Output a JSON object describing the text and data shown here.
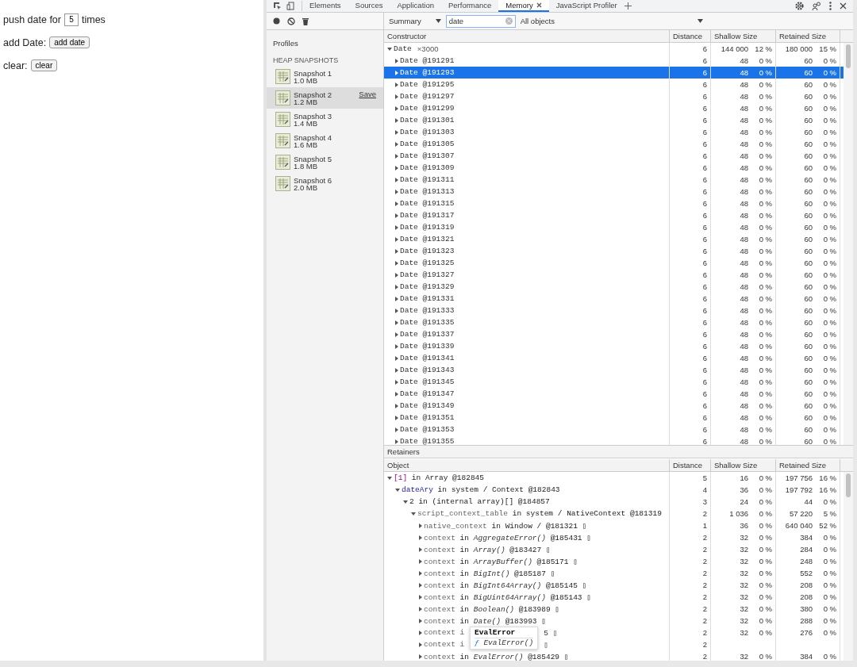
{
  "page": {
    "lines": [
      {
        "kind": "input",
        "label": "push date for",
        "value": "5",
        "after": "times"
      },
      {
        "kind": "button",
        "label": "add Date:",
        "button": "add date"
      },
      {
        "kind": "button",
        "label": "clear:",
        "button": "clear"
      }
    ]
  },
  "devtools": {
    "tabs": [
      {
        "label": "Elements",
        "selected": false,
        "closable": false
      },
      {
        "label": "Sources",
        "selected": false,
        "closable": false
      },
      {
        "label": "Application",
        "selected": false,
        "closable": false
      },
      {
        "label": "Performance",
        "selected": false,
        "closable": false
      },
      {
        "label": "Memory",
        "selected": true,
        "closable": true
      },
      {
        "label": "JavaScript Profiler",
        "selected": false,
        "closable": false
      }
    ],
    "toolbar": {
      "view": "Summary",
      "filter": "date",
      "objects": "All objects"
    },
    "sidebar": {
      "title": "Profiles",
      "section": "HEAP SNAPSHOTS",
      "snapshots": [
        {
          "name": "Snapshot 1",
          "size": "1.0 MB",
          "selected": false
        },
        {
          "name": "Snapshot 2",
          "size": "1.2 MB",
          "selected": true,
          "action": "Save"
        },
        {
          "name": "Snapshot 3",
          "size": "1.4 MB",
          "selected": false
        },
        {
          "name": "Snapshot 4",
          "size": "1.6 MB",
          "selected": false
        },
        {
          "name": "Snapshot 5",
          "size": "1.8 MB",
          "selected": false
        },
        {
          "name": "Snapshot 6",
          "size": "2.0 MB",
          "selected": false
        }
      ]
    },
    "summary": {
      "columns": [
        "Constructor",
        "Distance",
        "Shallow Size",
        "Retained Size"
      ],
      "rows": [
        {
          "label": "Date",
          "count": "×3000",
          "expanded": true,
          "selected": false,
          "distance": "6",
          "shallow": "144 000",
          "shallow_pct": "12 %",
          "retained": "180 000",
          "retained_pct": "15 %",
          "children": [
            {
              "label": "Date @191291",
              "expanded": false,
              "selected": false,
              "distance": "6",
              "shallow": "48",
              "shallow_pct": "0 %",
              "retained": "60",
              "retained_pct": "0 %"
            },
            {
              "label": "Date @191293",
              "expanded": false,
              "selected": true,
              "distance": "6",
              "shallow": "48",
              "shallow_pct": "0 %",
              "retained": "60",
              "retained_pct": "0 %"
            },
            {
              "label": "Date @191295",
              "expanded": false,
              "selected": false,
              "distance": "6",
              "shallow": "48",
              "shallow_pct": "0 %",
              "retained": "60",
              "retained_pct": "0 %"
            },
            {
              "label": "Date @191297",
              "expanded": false,
              "selected": false,
              "distance": "6",
              "shallow": "48",
              "shallow_pct": "0 %",
              "retained": "60",
              "retained_pct": "0 %"
            },
            {
              "label": "Date @191299",
              "expanded": false,
              "selected": false,
              "distance": "6",
              "shallow": "48",
              "shallow_pct": "0 %",
              "retained": "60",
              "retained_pct": "0 %"
            },
            {
              "label": "Date @191301",
              "expanded": false,
              "selected": false,
              "distance": "6",
              "shallow": "48",
              "shallow_pct": "0 %",
              "retained": "60",
              "retained_pct": "0 %"
            },
            {
              "label": "Date @191303",
              "expanded": false,
              "selected": false,
              "distance": "6",
              "shallow": "48",
              "shallow_pct": "0 %",
              "retained": "60",
              "retained_pct": "0 %"
            },
            {
              "label": "Date @191305",
              "expanded": false,
              "selected": false,
              "distance": "6",
              "shallow": "48",
              "shallow_pct": "0 %",
              "retained": "60",
              "retained_pct": "0 %"
            },
            {
              "label": "Date @191307",
              "expanded": false,
              "selected": false,
              "distance": "6",
              "shallow": "48",
              "shallow_pct": "0 %",
              "retained": "60",
              "retained_pct": "0 %"
            },
            {
              "label": "Date @191309",
              "expanded": false,
              "selected": false,
              "distance": "6",
              "shallow": "48",
              "shallow_pct": "0 %",
              "retained": "60",
              "retained_pct": "0 %"
            },
            {
              "label": "Date @191311",
              "expanded": false,
              "selected": false,
              "distance": "6",
              "shallow": "48",
              "shallow_pct": "0 %",
              "retained": "60",
              "retained_pct": "0 %"
            },
            {
              "label": "Date @191313",
              "expanded": false,
              "selected": false,
              "distance": "6",
              "shallow": "48",
              "shallow_pct": "0 %",
              "retained": "60",
              "retained_pct": "0 %"
            },
            {
              "label": "Date @191315",
              "expanded": false,
              "selected": false,
              "distance": "6",
              "shallow": "48",
              "shallow_pct": "0 %",
              "retained": "60",
              "retained_pct": "0 %"
            },
            {
              "label": "Date @191317",
              "expanded": false,
              "selected": false,
              "distance": "6",
              "shallow": "48",
              "shallow_pct": "0 %",
              "retained": "60",
              "retained_pct": "0 %"
            },
            {
              "label": "Date @191319",
              "expanded": false,
              "selected": false,
              "distance": "6",
              "shallow": "48",
              "shallow_pct": "0 %",
              "retained": "60",
              "retained_pct": "0 %"
            },
            {
              "label": "Date @191321",
              "expanded": false,
              "selected": false,
              "distance": "6",
              "shallow": "48",
              "shallow_pct": "0 %",
              "retained": "60",
              "retained_pct": "0 %"
            },
            {
              "label": "Date @191323",
              "expanded": false,
              "selected": false,
              "distance": "6",
              "shallow": "48",
              "shallow_pct": "0 %",
              "retained": "60",
              "retained_pct": "0 %"
            },
            {
              "label": "Date @191325",
              "expanded": false,
              "selected": false,
              "distance": "6",
              "shallow": "48",
              "shallow_pct": "0 %",
              "retained": "60",
              "retained_pct": "0 %"
            },
            {
              "label": "Date @191327",
              "expanded": false,
              "selected": false,
              "distance": "6",
              "shallow": "48",
              "shallow_pct": "0 %",
              "retained": "60",
              "retained_pct": "0 %"
            },
            {
              "label": "Date @191329",
              "expanded": false,
              "selected": false,
              "distance": "6",
              "shallow": "48",
              "shallow_pct": "0 %",
              "retained": "60",
              "retained_pct": "0 %"
            },
            {
              "label": "Date @191331",
              "expanded": false,
              "selected": false,
              "distance": "6",
              "shallow": "48",
              "shallow_pct": "0 %",
              "retained": "60",
              "retained_pct": "0 %"
            },
            {
              "label": "Date @191333",
              "expanded": false,
              "selected": false,
              "distance": "6",
              "shallow": "48",
              "shallow_pct": "0 %",
              "retained": "60",
              "retained_pct": "0 %"
            },
            {
              "label": "Date @191335",
              "expanded": false,
              "selected": false,
              "distance": "6",
              "shallow": "48",
              "shallow_pct": "0 %",
              "retained": "60",
              "retained_pct": "0 %"
            },
            {
              "label": "Date @191337",
              "expanded": false,
              "selected": false,
              "distance": "6",
              "shallow": "48",
              "shallow_pct": "0 %",
              "retained": "60",
              "retained_pct": "0 %"
            },
            {
              "label": "Date @191339",
              "expanded": false,
              "selected": false,
              "distance": "6",
              "shallow": "48",
              "shallow_pct": "0 %",
              "retained": "60",
              "retained_pct": "0 %"
            },
            {
              "label": "Date @191341",
              "expanded": false,
              "selected": false,
              "distance": "6",
              "shallow": "48",
              "shallow_pct": "0 %",
              "retained": "60",
              "retained_pct": "0 %"
            },
            {
              "label": "Date @191343",
              "expanded": false,
              "selected": false,
              "distance": "6",
              "shallow": "48",
              "shallow_pct": "0 %",
              "retained": "60",
              "retained_pct": "0 %"
            },
            {
              "label": "Date @191345",
              "expanded": false,
              "selected": false,
              "distance": "6",
              "shallow": "48",
              "shallow_pct": "0 %",
              "retained": "60",
              "retained_pct": "0 %"
            },
            {
              "label": "Date @191347",
              "expanded": false,
              "selected": false,
              "distance": "6",
              "shallow": "48",
              "shallow_pct": "0 %",
              "retained": "60",
              "retained_pct": "0 %"
            },
            {
              "label": "Date @191349",
              "expanded": false,
              "selected": false,
              "distance": "6",
              "shallow": "48",
              "shallow_pct": "0 %",
              "retained": "60",
              "retained_pct": "0 %"
            },
            {
              "label": "Date @191351",
              "expanded": false,
              "selected": false,
              "distance": "6",
              "shallow": "48",
              "shallow_pct": "0 %",
              "retained": "60",
              "retained_pct": "0 %"
            },
            {
              "label": "Date @191353",
              "expanded": false,
              "selected": false,
              "distance": "6",
              "shallow": "48",
              "shallow_pct": "0 %",
              "retained": "60",
              "retained_pct": "0 %"
            },
            {
              "label": "Date @191355",
              "expanded": false,
              "selected": false,
              "distance": "6",
              "shallow": "48",
              "shallow_pct": "0 %",
              "retained": "60",
              "retained_pct": "0 %"
            }
          ]
        }
      ]
    },
    "retainers": {
      "title": "Retainers",
      "columns": [
        "Object",
        "Distance",
        "Shallow Size",
        "Retained Size"
      ],
      "rows": [
        {
          "parts": [
            {
              "kind": "index",
              "t": "[1]"
            },
            {
              "kind": "plain",
              "t": " in Array @182845"
            }
          ],
          "expanded": true,
          "distance": "5",
          "shallow": "16",
          "shallow_pct": "0 %",
          "retained": "197 756",
          "retained_pct": "16 %",
          "children": [
            {
              "parts": [
                {
                  "kind": "prop",
                  "t": "dateAry"
                },
                {
                  "kind": "plain",
                  "t": " in system / Context @182843"
                }
              ],
              "expanded": true,
              "distance": "4",
              "shallow": "36",
              "shallow_pct": "0 %",
              "retained": "197 792",
              "retained_pct": "16 %",
              "children": [
                {
                  "parts": [
                    {
                      "kind": "plain",
                      "t": "2 in (internal array)[] @184857"
                    }
                  ],
                  "expanded": true,
                  "distance": "3",
                  "shallow": "24",
                  "shallow_pct": "0 %",
                  "retained": "44",
                  "retained_pct": "0 %",
                  "children": [
                    {
                      "parts": [
                        {
                          "kind": "dim",
                          "t": "script_context_table"
                        },
                        {
                          "kind": "plain",
                          "t": " in system / NativeContext @181319"
                        }
                      ],
                      "expanded": true,
                      "distance": "2",
                      "shallow": "1 036",
                      "shallow_pct": "0 %",
                      "retained": "57 220",
                      "retained_pct": "5 %",
                      "children": [
                        {
                          "parts": [
                            {
                              "kind": "dim",
                              "t": "native_context"
                            },
                            {
                              "kind": "plain",
                              "t": " in Window /  @181321 ▯"
                            }
                          ],
                          "expanded": false,
                          "distance": "1",
                          "shallow": "36",
                          "shallow_pct": "0 %",
                          "retained": "640 040",
                          "retained_pct": "52 %"
                        },
                        {
                          "parts": [
                            {
                              "kind": "dim",
                              "t": "context"
                            },
                            {
                              "kind": "plain",
                              "t": " in "
                            },
                            {
                              "kind": "italic",
                              "t": "AggregateError()"
                            },
                            {
                              "kind": "plain",
                              "t": " @185431 ▯"
                            }
                          ],
                          "expanded": false,
                          "distance": "2",
                          "shallow": "32",
                          "shallow_pct": "0 %",
                          "retained": "384",
                          "retained_pct": "0 %"
                        },
                        {
                          "parts": [
                            {
                              "kind": "dim",
                              "t": "context"
                            },
                            {
                              "kind": "plain",
                              "t": " in "
                            },
                            {
                              "kind": "italic",
                              "t": "Array()"
                            },
                            {
                              "kind": "plain",
                              "t": " @183427 ▯"
                            }
                          ],
                          "expanded": false,
                          "distance": "2",
                          "shallow": "32",
                          "shallow_pct": "0 %",
                          "retained": "284",
                          "retained_pct": "0 %"
                        },
                        {
                          "parts": [
                            {
                              "kind": "dim",
                              "t": "context"
                            },
                            {
                              "kind": "plain",
                              "t": " in "
                            },
                            {
                              "kind": "italic",
                              "t": "ArrayBuffer()"
                            },
                            {
                              "kind": "plain",
                              "t": " @185171 ▯"
                            }
                          ],
                          "expanded": false,
                          "distance": "2",
                          "shallow": "32",
                          "shallow_pct": "0 %",
                          "retained": "248",
                          "retained_pct": "0 %"
                        },
                        {
                          "parts": [
                            {
                              "kind": "dim",
                              "t": "context"
                            },
                            {
                              "kind": "plain",
                              "t": " in "
                            },
                            {
                              "kind": "italic",
                              "t": "BigInt()"
                            },
                            {
                              "kind": "plain",
                              "t": " @185187 ▯"
                            }
                          ],
                          "expanded": false,
                          "distance": "2",
                          "shallow": "32",
                          "shallow_pct": "0 %",
                          "retained": "552",
                          "retained_pct": "0 %"
                        },
                        {
                          "parts": [
                            {
                              "kind": "dim",
                              "t": "context"
                            },
                            {
                              "kind": "plain",
                              "t": " in "
                            },
                            {
                              "kind": "italic",
                              "t": "BigInt64Array()"
                            },
                            {
                              "kind": "plain",
                              "t": " @185145 ▯"
                            }
                          ],
                          "expanded": false,
                          "distance": "2",
                          "shallow": "32",
                          "shallow_pct": "0 %",
                          "retained": "208",
                          "retained_pct": "0 %"
                        },
                        {
                          "parts": [
                            {
                              "kind": "dim",
                              "t": "context"
                            },
                            {
                              "kind": "plain",
                              "t": " in "
                            },
                            {
                              "kind": "italic",
                              "t": "BigUint64Array()"
                            },
                            {
                              "kind": "plain",
                              "t": " @185143 ▯"
                            }
                          ],
                          "expanded": false,
                          "distance": "2",
                          "shallow": "32",
                          "shallow_pct": "0 %",
                          "retained": "208",
                          "retained_pct": "0 %"
                        },
                        {
                          "parts": [
                            {
                              "kind": "dim",
                              "t": "context"
                            },
                            {
                              "kind": "plain",
                              "t": " in "
                            },
                            {
                              "kind": "italic",
                              "t": "Boolean()"
                            },
                            {
                              "kind": "plain",
                              "t": " @183989 ▯"
                            }
                          ],
                          "expanded": false,
                          "distance": "2",
                          "shallow": "32",
                          "shallow_pct": "0 %",
                          "retained": "380",
                          "retained_pct": "0 %"
                        },
                        {
                          "parts": [
                            {
                              "kind": "dim",
                              "t": "context"
                            },
                            {
                              "kind": "plain",
                              "t": " in "
                            },
                            {
                              "kind": "italic",
                              "t": "Date()"
                            },
                            {
                              "kind": "plain",
                              "t": " @183993 ▯"
                            }
                          ],
                          "expanded": false,
                          "distance": "2",
                          "shallow": "32",
                          "shallow_pct": "0 %",
                          "retained": "288",
                          "retained_pct": "0 %"
                        },
                        {
                          "parts": [
                            {
                              "kind": "dim",
                              "t": "context i"
                            }
                          ],
                          "tail": "5 ▯",
                          "expanded": false,
                          "distance": "2",
                          "shallow": "32",
                          "shallow_pct": "0 %",
                          "retained": "276",
                          "retained_pct": "0 %"
                        },
                        {
                          "parts": [
                            {
                              "kind": "dim",
                              "t": "context i"
                            }
                          ],
                          "tail": "▯",
                          "expanded": false,
                          "distance": "2"
                        },
                        {
                          "parts": [
                            {
                              "kind": "dim",
                              "t": "context"
                            },
                            {
                              "kind": "plain",
                              "t": " in "
                            },
                            {
                              "kind": "italic",
                              "t": "EvalError()"
                            },
                            {
                              "kind": "plain",
                              "t": " @185429 ▯"
                            }
                          ],
                          "expanded": false,
                          "distance": "2",
                          "shallow": "32",
                          "shallow_pct": "0 %",
                          "retained": "384",
                          "retained_pct": "0 %"
                        }
                      ]
                    }
                  ]
                }
              ]
            }
          ]
        }
      ],
      "tooltip": {
        "title": "EvalError",
        "glyph": "ƒ",
        "text": "EvalError()"
      }
    }
  }
}
